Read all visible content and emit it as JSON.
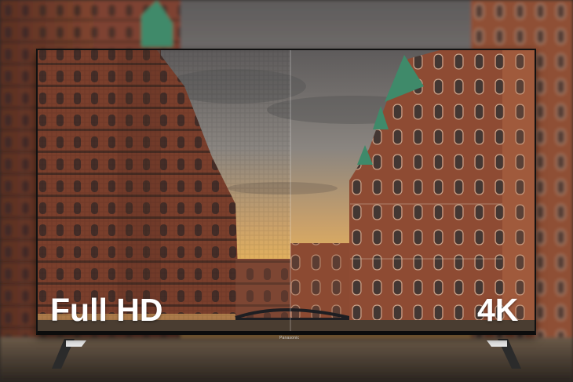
{
  "labels": {
    "left": "Full HD",
    "right": "4K"
  },
  "brand": "Panasonic",
  "colors": {
    "sky_top": "#6f6c6b",
    "sunset": "#e8b45a",
    "brick": "#8a4a33",
    "roof_green": "#3f8a6a",
    "tv_bezel": "#111111"
  }
}
